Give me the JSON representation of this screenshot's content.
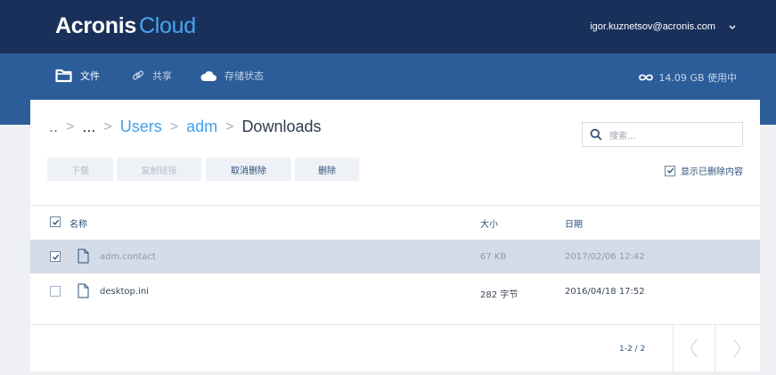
{
  "brand": {
    "name_bold": "Acronis",
    "name_light": "Cloud",
    "accent": "#49a5f0"
  },
  "account": {
    "email": "igor.kuznetsov@acronis.com",
    "icon": "chevron-down-icon"
  },
  "nav": {
    "items": [
      {
        "label": "文件",
        "icon": "folder-icon",
        "active": true
      },
      {
        "label": "共享",
        "icon": "link-icon",
        "active": false
      },
      {
        "label": "存储状态",
        "icon": "cloud-icon",
        "active": false
      }
    ],
    "storage": {
      "icon": "infinity-icon",
      "text": "14.09 GB 使用中"
    }
  },
  "breadcrumb": {
    "items": [
      "..",
      "...",
      "Users",
      "adm",
      "Downloads"
    ],
    "separator": ">"
  },
  "search": {
    "placeholder": "搜索...",
    "icon": "search-icon"
  },
  "actions": {
    "download": "下载",
    "copy_link": "复制链接",
    "undelete": "取消删除",
    "delete": "删除"
  },
  "show_deleted": {
    "label": "显示已删除内容",
    "checked": true
  },
  "table": {
    "columns": {
      "name": "名称",
      "size": "大小",
      "date": "日期"
    },
    "rows": [
      {
        "name": "adm.contact",
        "size": "67 KB",
        "date": "2017/02/06 12:42",
        "selected": true
      },
      {
        "name": "desktop.ini",
        "size": "282 字节",
        "date": "2016/04/18 17:52",
        "selected": false
      }
    ]
  },
  "pagination": {
    "range": "1-2 / 2"
  },
  "colors": {
    "topbar": "#19315a",
    "navbar": "#2c5d99",
    "link": "#43a0e8",
    "selected_row": "#d3dce7"
  }
}
